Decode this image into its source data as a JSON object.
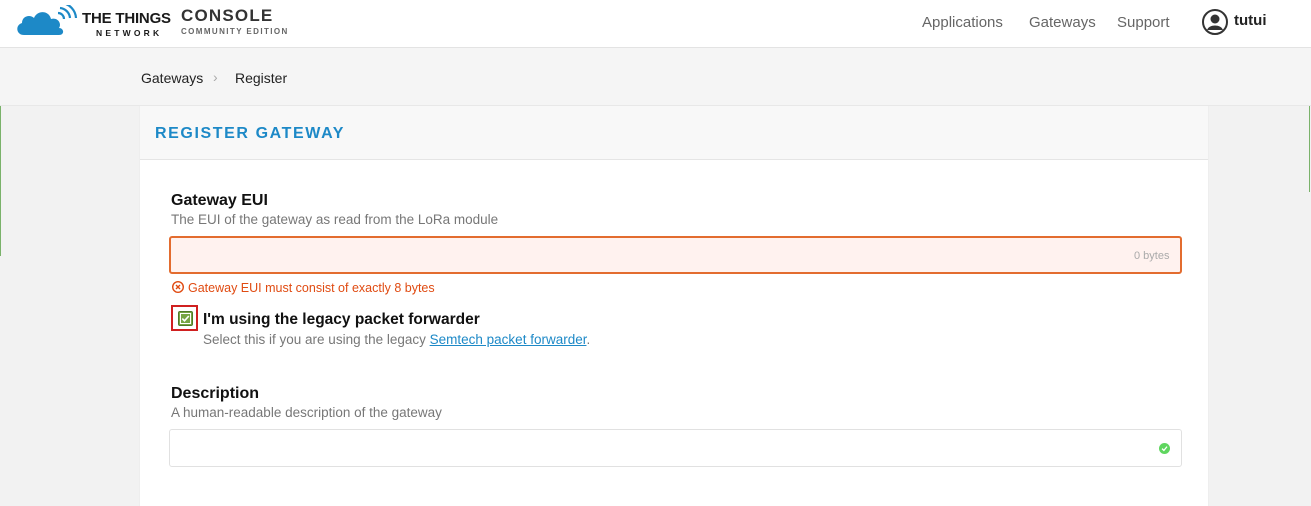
{
  "header": {
    "brand_main": "THE THINGS",
    "brand_sub": "NETWORK",
    "console_title": "CONSOLE",
    "console_sub": "COMMUNITY EDITION",
    "nav": {
      "applications": "Applications",
      "gateways": "Gateways",
      "support": "Support"
    },
    "user_name": "tutui",
    "icons": {
      "logo": "ttn-cloud-logo-icon",
      "user": "user-avatar-icon"
    }
  },
  "breadcrumb": {
    "items": [
      "Gateways",
      "Register"
    ],
    "separator": ">"
  },
  "panel": {
    "title": "REGISTER GATEWAY",
    "gateway_eui": {
      "label": "Gateway EUI",
      "help": "The EUI of the gateway as read from the LoRa module",
      "value": "",
      "byte_count": "0 bytes",
      "error": "Gateway EUI must consist of exactly 8 bytes"
    },
    "legacy_forwarder": {
      "label": "I'm using the legacy packet forwarder",
      "help_prefix": "Select this if you are using the legacy ",
      "help_link": "Semtech packet forwarder",
      "help_suffix": ".",
      "checked": true
    },
    "description": {
      "label": "Description",
      "help": "A human-readable description of the gateway",
      "value": ""
    }
  },
  "colors": {
    "accent": "#1d89c7",
    "error": "#e04b12",
    "checkbox": "#76a545",
    "valid": "#5fd65f"
  }
}
